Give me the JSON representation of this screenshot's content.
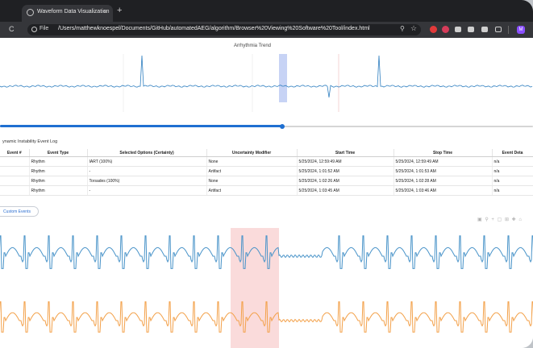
{
  "browser": {
    "tab_title": "Waveform Data Visualization",
    "tab_close": "×",
    "new_tab": "+",
    "reload": "C",
    "file_label": "File",
    "url": "/Users/matthewknoespel/Documents/GitHub/automatedAEG/algorithm/Browser%20Viewing%20Software%20Tool/index.html",
    "profile_initial": "M"
  },
  "trend": {
    "title": "Arrhythmia Trend",
    "line_color": "#2f7fc0",
    "selection_color": "#b9c8f2"
  },
  "timeline": {
    "progress": 0.53,
    "accent": "#1f6fd1"
  },
  "event_log": {
    "title": "ynamic Instability Event Log",
    "columns": [
      "Event #",
      "Event Type",
      "Selected Options (Certainty)",
      "Uncertainty Modifier",
      "Start Time",
      "Stop Time",
      "Event Deta"
    ],
    "rows": [
      [
        "",
        "Rhythm",
        "IART (100%)",
        "None",
        "5/25/2024, 12:59:49 AM",
        "5/25/2024, 12:59:49 AM",
        "n/a"
      ],
      [
        "",
        "Rhythm",
        "-",
        "Artifact",
        "5/25/2024, 1:01:52 AM",
        "5/25/2024, 1:01:53 AM",
        "n/a"
      ],
      [
        "",
        "Rhythm",
        "Torsades (100%)",
        "None",
        "5/25/2024, 1:02:26 AM",
        "5/25/2024, 1:02:28 AM",
        "n/a"
      ],
      [
        "",
        "Rhythm",
        "-",
        "Artifact",
        "5/25/2024, 1:03:45 AM",
        "5/25/2024, 1:03:46 AM",
        "n/a"
      ]
    ]
  },
  "custom_events_button": "Custom Events",
  "waveforms": {
    "top_color": "#4a94c9",
    "bottom_color": "#f3a14a",
    "highlight_color": "#f9d5d5"
  }
}
